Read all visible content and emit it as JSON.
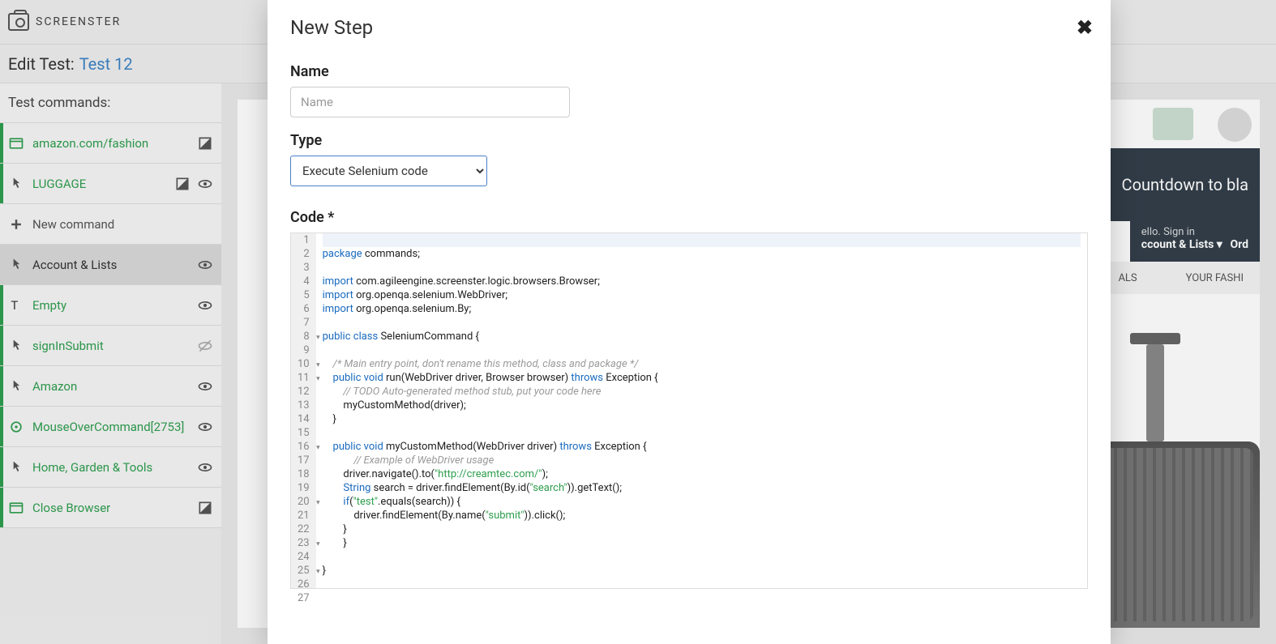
{
  "app": {
    "brand": "SCREENSTER"
  },
  "edit": {
    "prefix": "Edit Test:",
    "name": "Test 12"
  },
  "sidebar": {
    "header": "Test commands:",
    "items": [
      {
        "label": "amazon.com/fashion",
        "icon": "browser",
        "right": [
          "contrast"
        ]
      },
      {
        "label": "LUGGAGE",
        "icon": "pointer",
        "right": [
          "contrast",
          "eye"
        ]
      },
      {
        "label": "New command",
        "icon": "plus",
        "right": [],
        "muted": true
      },
      {
        "label": "Account & Lists",
        "icon": "pointer",
        "right": [
          "eye"
        ],
        "active": true
      },
      {
        "label": "Empty",
        "icon": "text",
        "right": [
          "eye"
        ]
      },
      {
        "label": "signInSubmit",
        "icon": "pointer",
        "right": [
          "eye-off"
        ]
      },
      {
        "label": "Amazon",
        "icon": "pointer",
        "right": [
          "eye"
        ]
      },
      {
        "label": "MouseOverCommand[2753]",
        "icon": "target",
        "right": [
          "eye"
        ]
      },
      {
        "label": "Home, Garden & Tools",
        "icon": "pointer",
        "right": [
          "eye"
        ]
      },
      {
        "label": "Close Browser",
        "icon": "browser",
        "right": [
          "contrast"
        ]
      }
    ]
  },
  "bg": {
    "promo": "Countdown to bla",
    "hello": "ello. Sign in",
    "account": "ccount & Lists",
    "ord": "Ord",
    "tab1": "ALS",
    "tab2": "YOUR FASHI"
  },
  "modal": {
    "title": "New Step",
    "name_label": "Name",
    "name_placeholder": "Name",
    "type_label": "Type",
    "type_value": "Execute Selenium code",
    "code_label": "Code *",
    "code_lines": [
      "",
      "<span class='kw'>package</span> commands;",
      "",
      "<span class='kw'>import</span> com.agileengine.screenster.logic.browsers.Browser;",
      "<span class='kw'>import</span> org.openqa.selenium.WebDriver;",
      "<span class='kw'>import</span> org.openqa.selenium.By;",
      "",
      "<span class='kw'>public</span> <span class='kw'>class</span> SeleniumCommand {",
      "",
      "    <span class='cm'>/* Main entry point, don't rename this method, class and package */</span>",
      "    <span class='kw'>public</span> <span class='kw'>void</span> run(WebDriver driver, Browser browser) <span class='kw'>throws</span> Exception {",
      "        <span class='cm'>// TODO Auto-generated method stub, put your code here</span>",
      "        myCustomMethod(driver);",
      "    }",
      "",
      "    <span class='kw'>public</span> <span class='kw'>void</span> myCustomMethod(WebDriver driver) <span class='kw'>throws</span> Exception {",
      "            <span class='cm'>// Example of WebDriver usage</span>",
      "        driver.navigate().to(<span class='str'>\"http://creamtec.com/\"</span>);",
      "        <span class='kw'>String</span> search = driver.findElement(By.id(<span class='str'>\"search\"</span>)).getText();",
      "        <span class='kw'>if</span>(<span class='str'>\"test\"</span>.equals(search)) {",
      "            driver.findElement(By.name(<span class='str'>\"submit\"</span>)).click();",
      "        }",
      "        }",
      "",
      "}",
      "",
      ""
    ],
    "fold_lines": [
      8,
      10,
      11,
      16,
      20,
      23,
      25
    ]
  }
}
